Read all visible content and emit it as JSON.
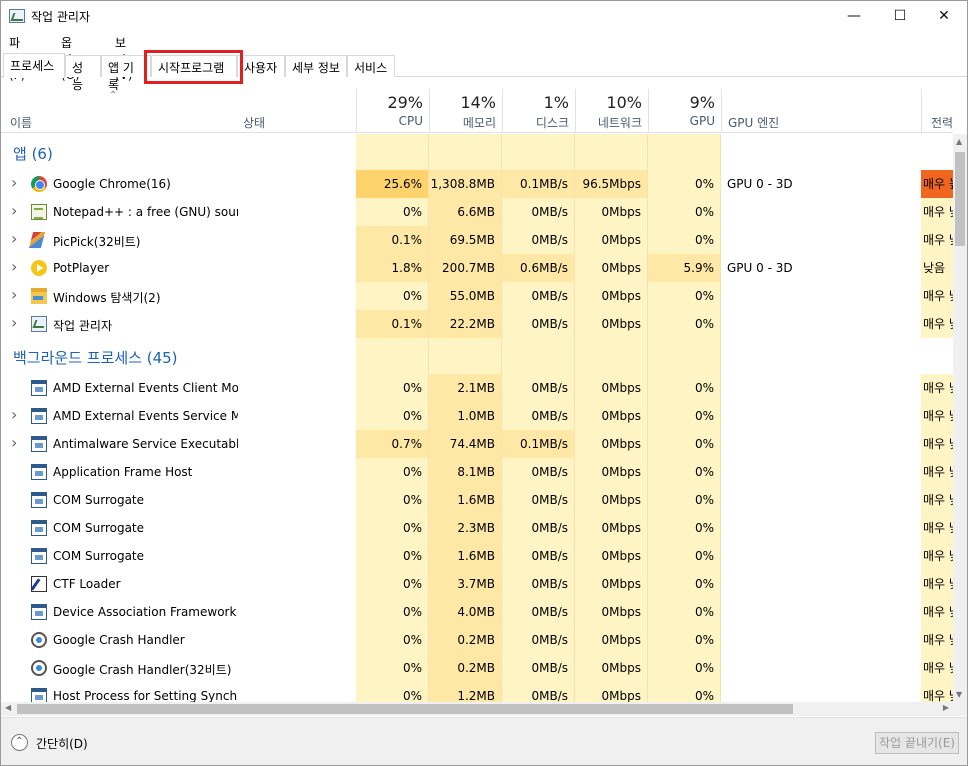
{
  "window": {
    "title": "작업 관리자"
  },
  "menu": [
    "파일(F)",
    "옵션(O)",
    "보기(V)"
  ],
  "tabs": [
    "프로세스",
    "성능",
    "앱 기록",
    "시작프로그램",
    "사용자",
    "세부 정보",
    "서비스"
  ],
  "active_tab": "프로세스",
  "highlighted_tab": "시작프로그램",
  "header": {
    "name": "이름",
    "status": "상태",
    "cpu_pct": "29%",
    "cpu": "CPU",
    "mem_pct": "14%",
    "mem": "메모리",
    "disk_pct": "1%",
    "disk": "디스크",
    "net_pct": "10%",
    "net": "네트워크",
    "gpu_pct": "9%",
    "gpu": "GPU",
    "gpu_engine": "GPU 엔진",
    "power": "전력 사용"
  },
  "groups": {
    "apps": "앱 (6)",
    "background": "백그라운드 프로세스 (45)"
  },
  "apps": [
    {
      "name": "Google Chrome(16)",
      "icon": "chrome-icon",
      "expand": true,
      "cpu": "25.6%",
      "mem": "1,308.8MB",
      "disk": "0.1MB/s",
      "net": "96.5Mbps",
      "gpu": "0%",
      "gpu_engine": "GPU 0 - 3D",
      "power": "매우 높음"
    },
    {
      "name": "Notepad++ : a free (GNU) sour...",
      "icon": "notepad-icon",
      "expand": true,
      "cpu": "0%",
      "mem": "6.6MB",
      "disk": "0MB/s",
      "net": "0Mbps",
      "gpu": "0%",
      "gpu_engine": "",
      "power": "매우 낮음"
    },
    {
      "name": "PicPick(32비트)",
      "icon": "picpick-icon",
      "expand": true,
      "cpu": "0.1%",
      "mem": "69.5MB",
      "disk": "0MB/s",
      "net": "0Mbps",
      "gpu": "0%",
      "gpu_engine": "",
      "power": "매우 낮음"
    },
    {
      "name": "PotPlayer",
      "icon": "potplayer-icon",
      "expand": true,
      "cpu": "1.8%",
      "mem": "200.7MB",
      "disk": "0.6MB/s",
      "net": "0Mbps",
      "gpu": "5.9%",
      "gpu_engine": "GPU 0 - 3D",
      "power": "낮음"
    },
    {
      "name": "Windows 탐색기(2)",
      "icon": "explorer-icon",
      "expand": true,
      "cpu": "0%",
      "mem": "55.0MB",
      "disk": "0MB/s",
      "net": "0Mbps",
      "gpu": "0%",
      "gpu_engine": "",
      "power": "매우 낮음"
    },
    {
      "name": "작업 관리자",
      "icon": "taskmgr-icon",
      "expand": true,
      "cpu": "0.1%",
      "mem": "22.2MB",
      "disk": "0MB/s",
      "net": "0Mbps",
      "gpu": "0%",
      "gpu_engine": "",
      "power": "매우 낮음"
    }
  ],
  "background": [
    {
      "name": "AMD External Events Client Mo...",
      "icon": "service-icon",
      "expand": false,
      "cpu": "0%",
      "mem": "2.1MB",
      "disk": "0MB/s",
      "net": "0Mbps",
      "gpu": "0%",
      "gpu_engine": "",
      "power": "매우 낮음"
    },
    {
      "name": "AMD External Events Service M...",
      "icon": "service-icon",
      "expand": true,
      "cpu": "0%",
      "mem": "1.0MB",
      "disk": "0MB/s",
      "net": "0Mbps",
      "gpu": "0%",
      "gpu_engine": "",
      "power": "매우 낮음"
    },
    {
      "name": "Antimalware Service Executable",
      "icon": "service-icon",
      "expand": true,
      "cpu": "0.7%",
      "mem": "74.4MB",
      "disk": "0.1MB/s",
      "net": "0Mbps",
      "gpu": "0%",
      "gpu_engine": "",
      "power": "매우 낮음"
    },
    {
      "name": "Application Frame Host",
      "icon": "service-icon",
      "expand": false,
      "cpu": "0%",
      "mem": "8.1MB",
      "disk": "0MB/s",
      "net": "0Mbps",
      "gpu": "0%",
      "gpu_engine": "",
      "power": "매우 낮음"
    },
    {
      "name": "COM Surrogate",
      "icon": "service-icon",
      "expand": false,
      "cpu": "0%",
      "mem": "1.6MB",
      "disk": "0MB/s",
      "net": "0Mbps",
      "gpu": "0%",
      "gpu_engine": "",
      "power": "매우 낮음"
    },
    {
      "name": "COM Surrogate",
      "icon": "service-icon",
      "expand": false,
      "cpu": "0%",
      "mem": "2.3MB",
      "disk": "0MB/s",
      "net": "0Mbps",
      "gpu": "0%",
      "gpu_engine": "",
      "power": "매우 낮음"
    },
    {
      "name": "COM Surrogate",
      "icon": "service-icon",
      "expand": false,
      "cpu": "0%",
      "mem": "1.6MB",
      "disk": "0MB/s",
      "net": "0Mbps",
      "gpu": "0%",
      "gpu_engine": "",
      "power": "매우 낮음"
    },
    {
      "name": "CTF Loader",
      "icon": "ctf-icon",
      "expand": false,
      "cpu": "0%",
      "mem": "3.7MB",
      "disk": "0MB/s",
      "net": "0Mbps",
      "gpu": "0%",
      "gpu_engine": "",
      "power": "매우 낮음"
    },
    {
      "name": "Device Association Framework ...",
      "icon": "service-icon",
      "expand": false,
      "cpu": "0%",
      "mem": "4.0MB",
      "disk": "0MB/s",
      "net": "0Mbps",
      "gpu": "0%",
      "gpu_engine": "",
      "power": "매우 낮음"
    },
    {
      "name": "Google Crash Handler",
      "icon": "crash-handler-icon",
      "expand": false,
      "cpu": "0%",
      "mem": "0.2MB",
      "disk": "0MB/s",
      "net": "0Mbps",
      "gpu": "0%",
      "gpu_engine": "",
      "power": "매우 낮음"
    },
    {
      "name": "Google Crash Handler(32비트)",
      "icon": "crash-handler-icon",
      "expand": false,
      "cpu": "0%",
      "mem": "0.2MB",
      "disk": "0MB/s",
      "net": "0Mbps",
      "gpu": "0%",
      "gpu_engine": "",
      "power": "매우 낮음"
    },
    {
      "name": "Host Process for Setting Synch...",
      "icon": "service-icon",
      "expand": false,
      "cpu": "0%",
      "mem": "1.2MB",
      "disk": "0MB/s",
      "net": "0Mbps",
      "gpu": "0%",
      "gpu_engine": "",
      "power": "매우 낮음"
    }
  ],
  "footer": {
    "collapse": "간단히(D)",
    "end_task": "작업 끝내기(E)"
  },
  "colors": {
    "heat_light": "#fff4c4",
    "heat_mid": "#ffe8a6",
    "heat_strong": "#ffd36b",
    "power_high": "#f0661f",
    "group_title": "#1c62b9"
  }
}
